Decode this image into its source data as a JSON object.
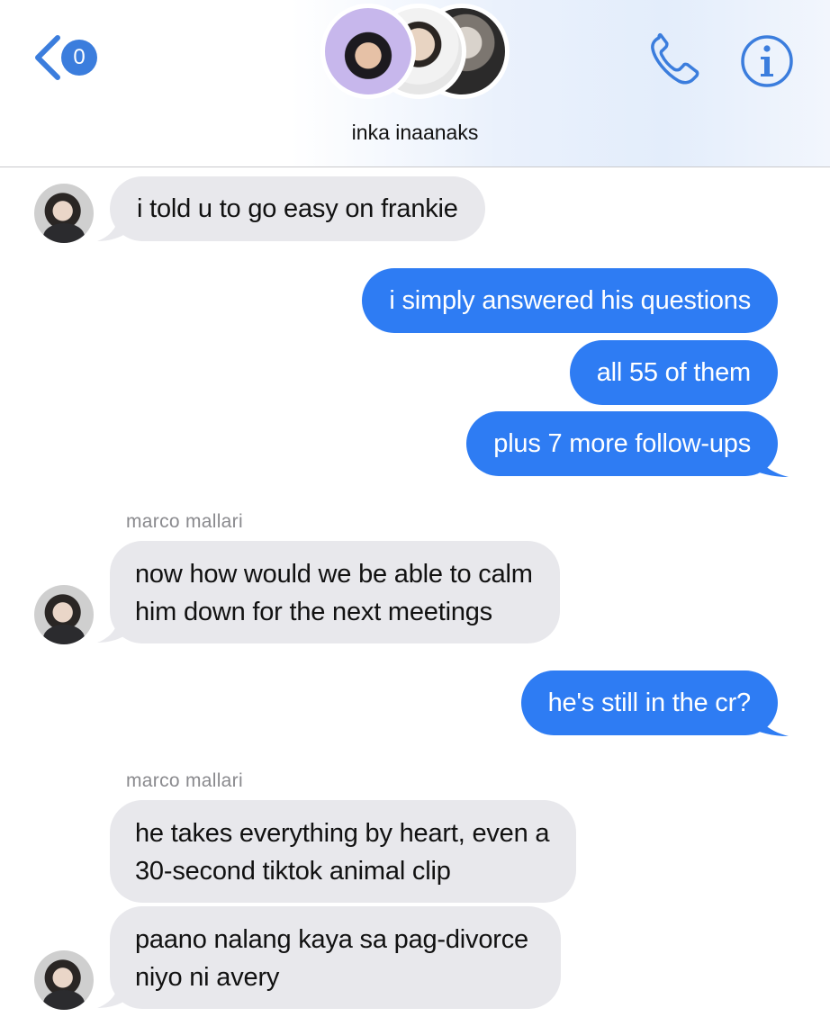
{
  "header": {
    "unread_count": "0",
    "group_name": "inka inaanaks",
    "accent_color": "#3b7ddd",
    "icons": [
      "back-chevron-icon",
      "phone-icon",
      "info-icon"
    ]
  },
  "messages": [
    {
      "direction": "incoming",
      "text": "i told u to go easy on frankie"
    },
    {
      "direction": "outgoing",
      "text": "i simply answered his questions"
    },
    {
      "direction": "outgoing",
      "text": "all 55 of them"
    },
    {
      "direction": "outgoing",
      "text": "plus 7 more follow-ups"
    },
    {
      "direction": "incoming",
      "sender": "marco mallari",
      "lines": [
        "now how would we be able to calm",
        "him down for the next meetings"
      ]
    },
    {
      "direction": "outgoing",
      "text": "he's still in the cr?"
    },
    {
      "direction": "incoming",
      "sender": "marco mallari",
      "lines": [
        "he takes everything by heart, even a",
        "30-second tiktok animal clip"
      ]
    },
    {
      "direction": "incoming",
      "lines": [
        "paano nalang kaya sa pag-divorce",
        "niyo ni avery"
      ]
    }
  ],
  "colors": {
    "incoming_bubble": "#e8e8ec",
    "outgoing_bubble": "#2e7cf3",
    "sender_label": "#8a8a8e"
  }
}
